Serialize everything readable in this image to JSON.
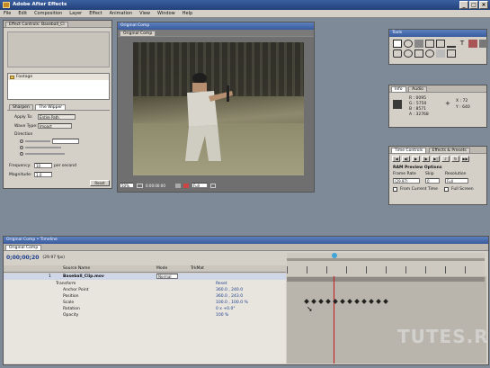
{
  "window": {
    "title": "Adobe After Effects"
  },
  "menu": [
    "File",
    "Edit",
    "Composition",
    "Layer",
    "Effect",
    "Animation",
    "View",
    "Window",
    "Help"
  ],
  "project": {
    "tabs": [
      "Effect Controls: Baseball_Cl"
    ],
    "footage_label": "Footage",
    "effect_tabs": [
      "Sharpen",
      "The Wipper"
    ],
    "apply_to": {
      "label": "Apply To:",
      "value": "Entire Path"
    },
    "wave_type": {
      "label": "Wave Type:",
      "value": "Impact"
    },
    "direction_label": "Direction",
    "frequency": {
      "label": "Frequency:",
      "value": "10",
      "unit": "per second"
    },
    "magnitude": {
      "label": "Magnitude:",
      "value": "1.0"
    },
    "reset": "Reset"
  },
  "comp": {
    "title": "Original Comp",
    "tab": "Original Comp",
    "zoom": "50%",
    "timecode": "0:00:00:00",
    "res": "Full"
  },
  "tools": {
    "title": "Tools"
  },
  "info": {
    "tabs": [
      "Info",
      "Audio"
    ],
    "values": [
      {
        "k": "R :",
        "v": "0095"
      },
      {
        "k": "G :",
        "v": "5750"
      },
      {
        "k": "B :",
        "v": "8571"
      },
      {
        "k": "A :",
        "v": "32768"
      }
    ],
    "xy": [
      {
        "k": "X :",
        "v": "72"
      },
      {
        "k": "Y :",
        "v": "640"
      }
    ]
  },
  "time_controls": {
    "tabs": [
      "Time Controls",
      "Effects & Presets"
    ],
    "ram_preview": "RAM Preview Options",
    "frame_rate": {
      "label": "Frame Rate",
      "value": "(29.97)"
    },
    "skip": {
      "label": "Skip",
      "value": "0"
    },
    "resolution": {
      "label": "Resolution",
      "value": "Full"
    },
    "from_current": "From Current Time",
    "full_screen": "Full Screen"
  },
  "timeline": {
    "title": "Original Comp • Timeline",
    "tab": "Original Comp",
    "timecode": "0;00;00;20",
    "fps": "(29.97 fps)",
    "headers": {
      "source": "Source Name",
      "mode": "Mode",
      "trkmat": "TrkMat"
    },
    "layer": {
      "index": "1",
      "name": "Baseball_Clip.mov",
      "mode": "Normal"
    },
    "props": [
      {
        "name": "Transform",
        "value": "Reset"
      },
      {
        "name": "Anchor Point",
        "value": "360.0 , 240.0"
      },
      {
        "name": "Position",
        "value": "360.0 , 243.0"
      },
      {
        "name": "Scale",
        "value": "100.0 , 100.0 %"
      },
      {
        "name": "Rotation",
        "value": "0 x +0.0°"
      },
      {
        "name": "Opacity",
        "value": "100 %"
      }
    ]
  },
  "watermark": "TUTES.RU",
  "colors": {
    "title_active": "#3b5c9c",
    "panel": "#d4d0c8",
    "desktop": "#7f8a98"
  }
}
